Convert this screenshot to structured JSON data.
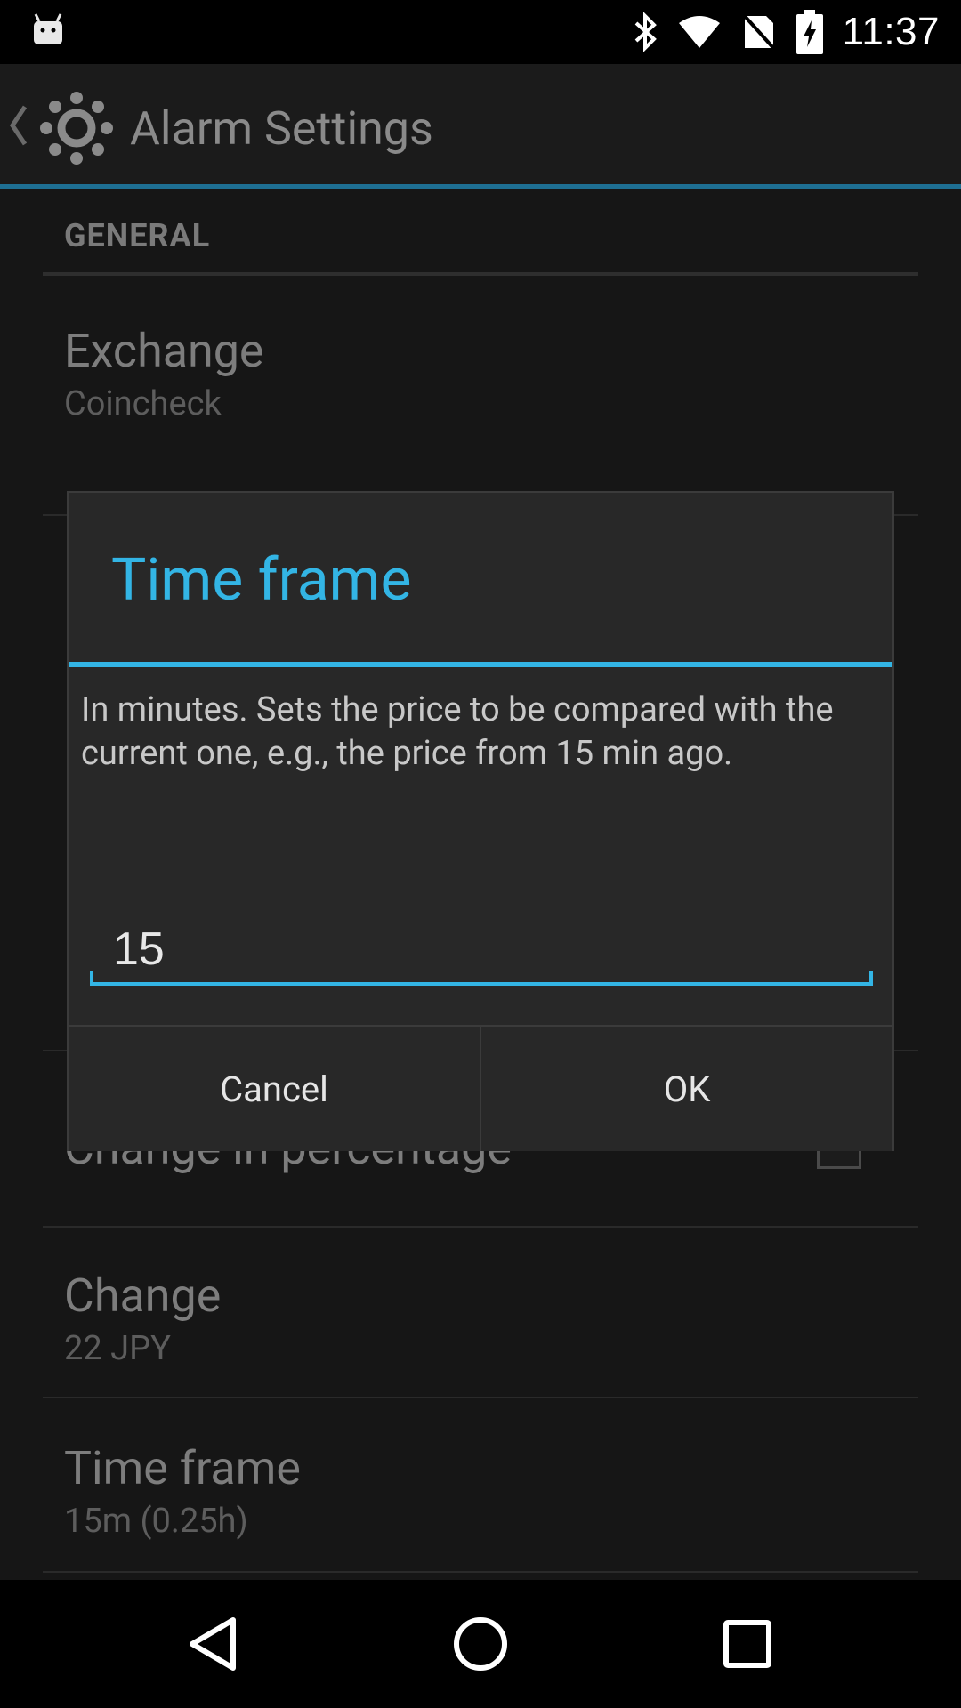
{
  "status_bar": {
    "time": "11:37",
    "icons": [
      "android-debug-icon",
      "bluetooth-icon",
      "wifi-icon",
      "battery-charging-icon"
    ]
  },
  "action_bar": {
    "title": "Alarm Settings",
    "icons": [
      "back-caret-icon",
      "settings-gear-icon"
    ]
  },
  "settings": {
    "section_header": "GENERAL",
    "items": [
      {
        "title": "Exchange",
        "summary": "Coincheck"
      },
      {
        "title": "Change in percentage",
        "summary": ""
      },
      {
        "title": "Change",
        "summary": "22 JPY"
      },
      {
        "title": "Time frame",
        "summary": "15m (0.25h)"
      }
    ]
  },
  "dialog": {
    "title": "Time frame",
    "message": "In minutes. Sets the price to be compared with the current one, e.g., the price from 15 min ago.",
    "input_value": "15",
    "cancel_label": "Cancel",
    "ok_label": "OK"
  },
  "nav_bar": {
    "icons": [
      "back-triangle-icon",
      "home-circle-icon",
      "recents-square-icon"
    ]
  },
  "colors": {
    "accent": "#33b5e5",
    "dialog_bg": "#282828",
    "background": "#161616"
  }
}
